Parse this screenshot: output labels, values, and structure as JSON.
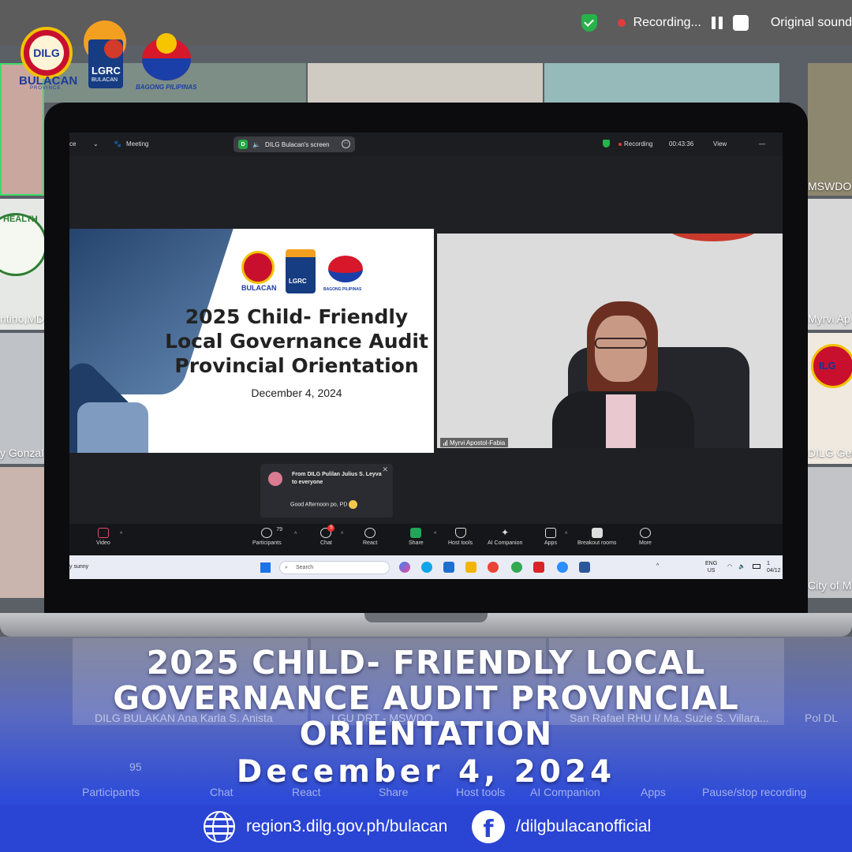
{
  "zoom_top_bar": {
    "recording_label": "Recording...",
    "original_sound_label": "Original sound"
  },
  "logos": {
    "dilg": "DILG",
    "dilg_bulacan": "BULACAN",
    "dilg_province": "PROVINCE",
    "lgrc": "LGRC",
    "lgrc_sub": "BULACAN",
    "bagong_pilipinas": "BAGONG PILIPINAS"
  },
  "gallery_tiles": {
    "left_name_1": "ntino,MD",
    "left_name_2": "y Gonzal",
    "left_health_logo": "HEALTH",
    "right_name_1": "MSWDO",
    "right_name_2": "Myrvi Ap",
    "right_name_3": "DILG Ger",
    "right_name_4": "City of M",
    "right_logo": "ILG"
  },
  "screen": {
    "top": {
      "left_text": "ce",
      "meeting_label": "Meeting",
      "share_initial": "D",
      "share_label": "DILG Bulacan's screen",
      "recording_label": "Recording",
      "timer": "00:43:36",
      "view_label": "View",
      "minimize": "—"
    },
    "slide": {
      "title_line1": "2025 Child- Friendly",
      "title_line2": "Local Governance Audit",
      "title_line3": "Provincial Orientation",
      "date": "December 4, 2024",
      "logo_bulacan": "BULACAN",
      "logo_lgrc": "LGRC",
      "logo_bagong": "BAGONG PILIPINAS"
    },
    "speaker": {
      "name": "Myrvi Apostol-Fabia"
    },
    "chat": {
      "header": "From DILG Pulilan Julius S. Leyva to everyone",
      "message": "Good Afternoon po, PD",
      "close": "✕"
    },
    "toolbar": {
      "video": "Video",
      "participants": "Participants",
      "participants_count": "79",
      "chat": "Chat",
      "chat_badge": "5",
      "react": "React",
      "share": "Share",
      "host_tools": "Host tools",
      "ai_companion": "AI Companion",
      "apps": "Apps",
      "breakout": "Breakout rooms",
      "more": "More"
    },
    "taskbar": {
      "weather": "y sunny",
      "search": "Search",
      "lang_line1": "ENG",
      "lang_line2": "US",
      "clock_line1": "1",
      "clock_line2": "04/12"
    }
  },
  "bg_bottom": {
    "name_1": "DILG BULAKAN Ana Karla S. Anista",
    "name_2": "LGU DRT - MSWDO",
    "name_3": "San Rafael RHU I/ Ma. Suzie S. Villara...",
    "name_4": "Pol DL",
    "participants": "Participants",
    "participants_count": "95",
    "chat": "Chat",
    "react": "React",
    "share": "Share",
    "host_tools": "Host tools",
    "ai_companion": "AI Companion",
    "apps": "Apps",
    "pause_stop": "Pause/stop recording"
  },
  "banner": {
    "line1": "2025 CHILD- FRIENDLY LOCAL",
    "line2": "GOVERNANCE AUDIT PROVINCIAL",
    "line3": "ORIENTATION",
    "date": "December 4, 2024",
    "website": "region3.dilg.gov.ph/bulacan",
    "facebook": "/dilgbulacanofficial"
  },
  "colors": {
    "banner_blue": "#2a44d4",
    "recording_red": "#e23b3b",
    "shield_green": "#26b34a",
    "dilg_red": "#c8102e",
    "dilg_gold": "#f2c200"
  }
}
